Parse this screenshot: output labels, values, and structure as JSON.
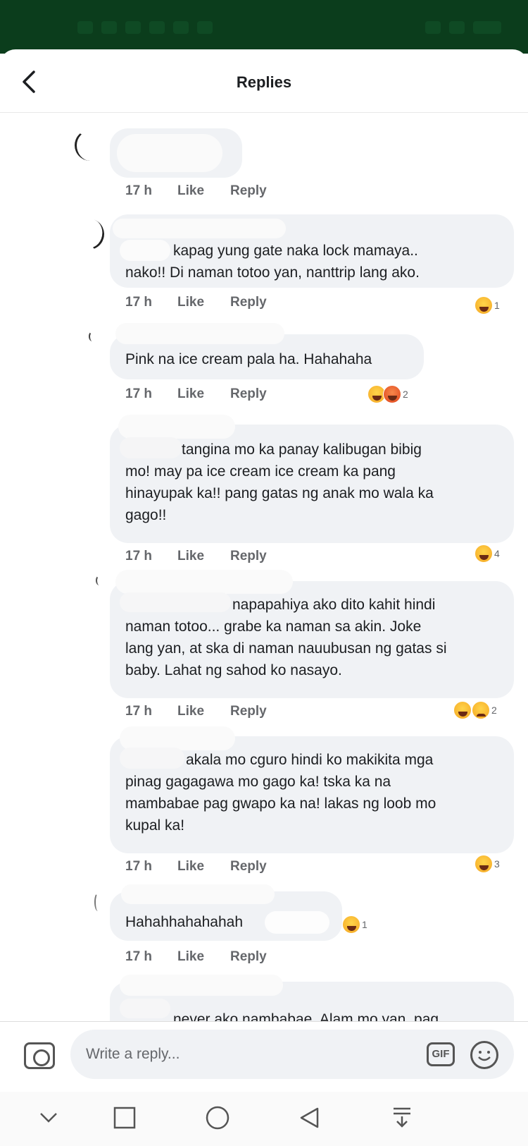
{
  "header": {
    "title": "Replies"
  },
  "comments": [
    {
      "text_lines": [],
      "time": "17 h",
      "like": "Like",
      "reply": "Reply",
      "reaction_count": ""
    },
    {
      "text_lines": [
        "kapag yung gate naka lock mamaya..",
        "nako!! Di naman totoo yan, nanttrip lang ako."
      ],
      "time": "17 h",
      "like": "Like",
      "reply": "Reply",
      "reaction_count": "1"
    },
    {
      "text_lines": [
        "Pink na ice cream pala ha. Hahahaha"
      ],
      "time": "17 h",
      "like": "Like",
      "reply": "Reply",
      "reaction_count": "2"
    },
    {
      "text_lines": [
        "tangina mo ka panay kalibugan bibig",
        "mo! may pa ice cream ice cream ka pang",
        "hinayupak ka!! pang gatas ng anak mo wala ka",
        "gago!!"
      ],
      "time": "17 h",
      "like": "Like",
      "reply": "Reply",
      "reaction_count": "4"
    },
    {
      "text_lines": [
        "napapahiya ako dito kahit hindi",
        "naman totoo... grabe ka naman sa akin. Joke",
        "lang yan, at ska di naman nauubusan ng gatas si",
        "baby. Lahat ng sahod ko nasayo."
      ],
      "time": "17 h",
      "like": "Like",
      "reply": "Reply",
      "reaction_count": "2"
    },
    {
      "text_lines": [
        "akala mo cguro hindi ko makikita mga",
        "pinag gagagawa mo gago ka! tska ka na",
        "mambabae pag gwapo ka na! lakas ng loob mo",
        "kupal ka!"
      ],
      "time": "17 h",
      "like": "Like",
      "reply": "Reply",
      "reaction_count": "3"
    },
    {
      "text_lines": [
        "Hahahhahahahah"
      ],
      "time": "17 h",
      "like": "Like",
      "reply": "Reply",
      "reaction_count": "1"
    },
    {
      "text_lines": [
        "never ako nambabae. Alam mo yan, pag"
      ],
      "time": "",
      "like": "",
      "reply": "",
      "reaction_count": ""
    }
  ],
  "composer": {
    "placeholder": "Write a reply...",
    "gif_label": "GIF"
  },
  "icons": {
    "back": "chevron-left-icon",
    "camera": "camera-icon",
    "gif": "gif-icon",
    "emoji": "smiley-icon",
    "nav": [
      "chevron-down-icon",
      "square-icon",
      "circle-icon",
      "triangle-back-icon",
      "download-icon"
    ]
  }
}
